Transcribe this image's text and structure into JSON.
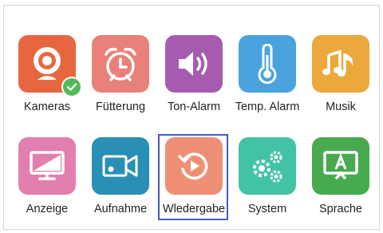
{
  "menu": {
    "items": [
      {
        "label": "Kameras",
        "icon": "camera-icon",
        "color": "#e8663f",
        "status": "check"
      },
      {
        "label": "Fütterung",
        "icon": "alarm-clock-icon",
        "color": "#e9807a"
      },
      {
        "label": "Ton-Alarm",
        "icon": "speaker-icon",
        "color": "#a65bb0"
      },
      {
        "label": "Temp. Alarm",
        "icon": "thermometer-icon",
        "color": "#4aa3dd"
      },
      {
        "label": "Musik",
        "icon": "music-note-icon",
        "color": "#eca83c"
      },
      {
        "label": "Anzeige",
        "icon": "monitor-icon",
        "color": "#e27fae"
      },
      {
        "label": "Aufnahme",
        "icon": "video-camera-icon",
        "color": "#2a8fb4"
      },
      {
        "label": "Wledergabe",
        "icon": "replay-icon",
        "color": "#ef8f76",
        "selected": true
      },
      {
        "label": "System",
        "icon": "gears-icon",
        "color": "#43c3a5"
      },
      {
        "label": "Sprache",
        "icon": "language-icon",
        "color": "#47aa4f"
      }
    ]
  }
}
